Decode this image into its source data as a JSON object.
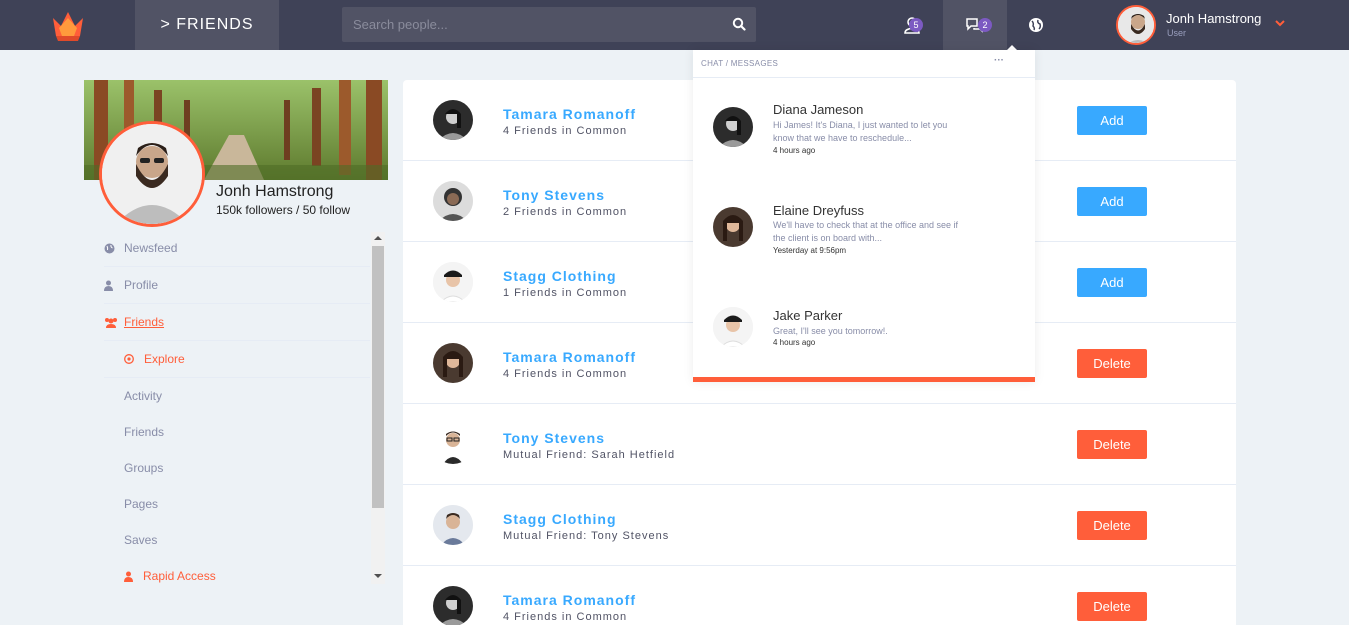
{
  "topbar": {
    "section_title": "> FRIENDS",
    "search_placeholder": "Search people...",
    "friend_requests_count": "5",
    "messages_count": "2",
    "user_name": "Jonh Hamstrong",
    "user_role": "User"
  },
  "profile": {
    "name": "Jonh Hamstrong",
    "stats": "150k followers / 50 follow"
  },
  "sidebar": {
    "items": [
      {
        "label": "Newsfeed",
        "icon": "globe-icon"
      },
      {
        "label": "Profile",
        "icon": "user-icon"
      },
      {
        "label": "Friends",
        "icon": "users-icon"
      },
      {
        "label": "Explore",
        "icon": "compass-icon"
      }
    ],
    "sub_items": [
      "Activity",
      "Friends",
      "Groups",
      "Pages",
      "Saves"
    ],
    "rapid_access": "Rapid Access"
  },
  "friends": [
    {
      "name": "Tamara Romanoff",
      "sub": "4 Friends in Common",
      "action": "Add"
    },
    {
      "name": "Tony Stevens",
      "sub": "2 Friends in Common",
      "action": "Add"
    },
    {
      "name": "Stagg Clothing",
      "sub": "1 Friends in Common",
      "action": "Add"
    },
    {
      "name": "Tamara Romanoff",
      "sub": "4 Friends in Common",
      "action": "Delete"
    },
    {
      "name": "Tony Stevens",
      "sub": "Mutual Friend: Sarah Hetfield",
      "action": "Delete"
    },
    {
      "name": "Stagg Clothing",
      "sub": "Mutual Friend: Tony Stevens",
      "action": "Delete"
    },
    {
      "name": "Tamara Romanoff",
      "sub": "4 Friends in Common",
      "action": "Delete"
    }
  ],
  "chat": {
    "title": "CHAT / MESSAGES",
    "more": "···",
    "messages": [
      {
        "name": "Diana Jameson",
        "text": "Hi James! It's Diana, I just wanted to let you know that we have to reschedule...",
        "time": "4 hours ago"
      },
      {
        "name": "Elaine Dreyfuss",
        "text": "We'll have to check that at the office and see if the client is on board with...",
        "time": "Yesterday at 9:56pm"
      },
      {
        "name": "Jake Parker",
        "text": "Great, I'll see you tomorrow!.",
        "time": "4 hours ago"
      }
    ]
  },
  "colors": {
    "topbar": "#3f4257",
    "accent_orange": "#ff5e3a",
    "accent_blue": "#38a9ff",
    "badge_purple": "#7c5ac2"
  }
}
